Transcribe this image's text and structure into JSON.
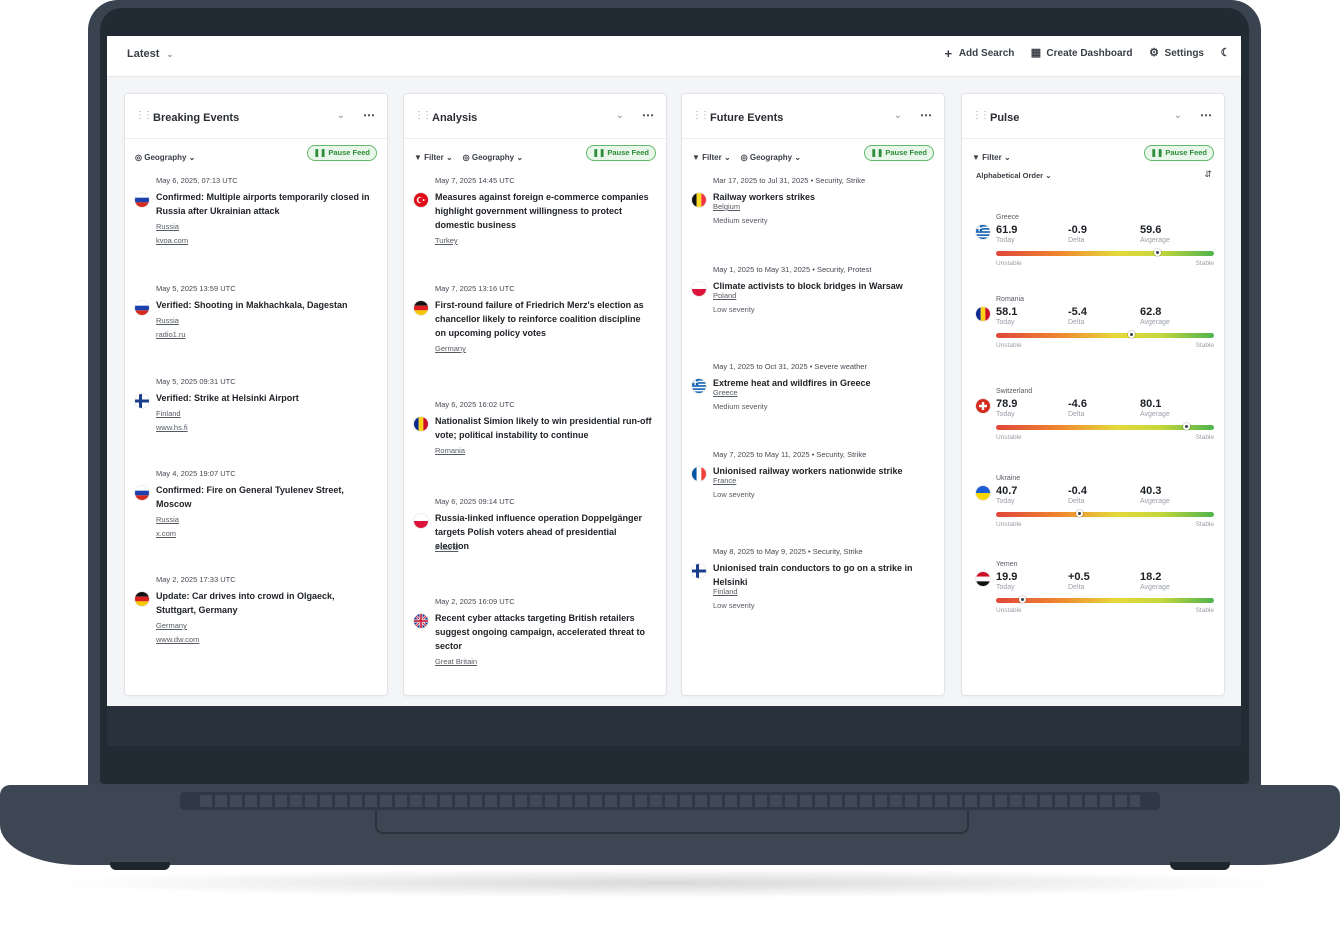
{
  "topbar": {
    "view_label": "Latest",
    "add_search": "Add Search",
    "create_dashboard": "Create Dashboard",
    "settings": "Settings"
  },
  "pause_label": "Pause Feed",
  "filter_label": "Filter",
  "geography_label": "Geography",
  "breaking": {
    "title": "Breaking Events",
    "items": [
      {
        "date": "May 6, 2025, 07:13 UTC",
        "title": "Confirmed: Multiple airports temporarily closed in Russia after Ukrainian attack",
        "country": "Russia",
        "source": "kvoa.com",
        "flag": "russia"
      },
      {
        "date": "May 5, 2025 13:59 UTC",
        "title": "Verified: Shooting in Makhachkala, Dagestan",
        "country": "Russia",
        "source": "radio1.ru",
        "flag": "russia"
      },
      {
        "date": "May 5, 2025 09:31 UTC",
        "title": "Verified: Strike at Helsinki Airport",
        "country": "Finland",
        "source": "www.hs.fi",
        "flag": "finland"
      },
      {
        "date": "May 4, 2025 19:07 UTC",
        "title": "Confirmed: Fire on General Tyulenev Street, Moscow",
        "country": "Russia",
        "source": "x.com",
        "flag": "russia"
      },
      {
        "date": "May 2, 2025 17:33 UTC",
        "title": "Update: Car drives into crowd in Olgaeck, Stuttgart, Germany",
        "country": "Germany",
        "source": "www.dw.com",
        "flag": "germany"
      }
    ]
  },
  "analysis": {
    "title": "Analysis",
    "items": [
      {
        "date": "May 7, 2025 14:45 UTC",
        "title": "Measures against foreign e-commerce companies highlight government willingness to protect domestic business",
        "country": "Turkey",
        "flag": "turkey"
      },
      {
        "date": "May 7, 2025 13:16 UTC",
        "title": "First-round failure of Friedrich Merz's election as chancellor likely to reinforce coalition discipline on upcoming policy votes",
        "country": "Germany",
        "flag": "germany"
      },
      {
        "date": "May 6, 2025 16:02 UTC",
        "title": "Nationalist Simion likely to win presidential run-off vote; political instability to continue",
        "country": "Romania",
        "flag": "romania"
      },
      {
        "date": "May 6, 2025 09:14 UTC",
        "title": "Russia-linked influence operation Doppelgänger targets Polish voters ahead of presidential election",
        "country": "Poland",
        "flag": "poland"
      },
      {
        "date": "May 2, 2025 16:09 UTC",
        "title": "Recent cyber attacks targeting British retailers suggest ongoing campaign, accelerated threat to sector",
        "country": "Great Britain",
        "flag": "uk"
      }
    ]
  },
  "future": {
    "title": "Future Events",
    "items": [
      {
        "date": "Mar 17, 2025 to Jul 31, 2025  •  Security, Strike",
        "title": "Railway workers strikes",
        "country": "Belgium",
        "severity": "Medium severity",
        "flag": "belgium"
      },
      {
        "date": "May 1, 2025 to May 31, 2025  •  Security, Protest",
        "title": "Climate activists to block bridges in Warsaw",
        "country": "Poland",
        "severity": "Low severity",
        "flag": "poland"
      },
      {
        "date": "May 1, 2025 to Oct 31, 2025 • Severe weather",
        "title": "Extreme heat and wildfires in Greece",
        "country": "Greece",
        "severity": "Medium severity",
        "flag": "greece"
      },
      {
        "date": "May 7, 2025 to May 11, 2025 • Security, Strike",
        "title": "Unionised railway workers nationwide strike",
        "country": "France",
        "severity": "Low severity",
        "flag": "france"
      },
      {
        "date": "May 8, 2025 to May 9, 2025 • Security, Strike",
        "title": "Unionised train conductors to go on a strike in Helsinki",
        "country": "Finland",
        "severity": "Low severity",
        "flag": "finland"
      }
    ]
  },
  "pulse": {
    "title": "Pulse",
    "sort_label": "Alphabetical Order",
    "today_label": "Today",
    "delta_label": "Delta",
    "average_label": "Avgerage",
    "unstable_label": "Unstable",
    "stable_label": "Stable",
    "rows": [
      {
        "country": "Greece",
        "today": "61.9",
        "delta": "-0.9",
        "average": "59.6",
        "level": 0.74,
        "flag": "greece"
      },
      {
        "country": "Romania",
        "today": "58.1",
        "delta": "-5.4",
        "average": "62.8",
        "level": 0.62,
        "flag": "romania"
      },
      {
        "country": "Switzerland",
        "today": "78.9",
        "delta": "-4.6",
        "average": "80.1",
        "level": 0.87,
        "flag": "switzerland"
      },
      {
        "country": "Ukraine",
        "today": "40.7",
        "delta": "-0.4",
        "average": "40.3",
        "level": 0.38,
        "flag": "ukraine"
      },
      {
        "country": "Yemen",
        "today": "19.9",
        "delta": "+0.5",
        "average": "18.2",
        "level": 0.12,
        "flag": "yemen"
      }
    ]
  },
  "colors": {
    "accent_green": "#2e8b3a",
    "pause_bg": "#e9f7ea"
  }
}
